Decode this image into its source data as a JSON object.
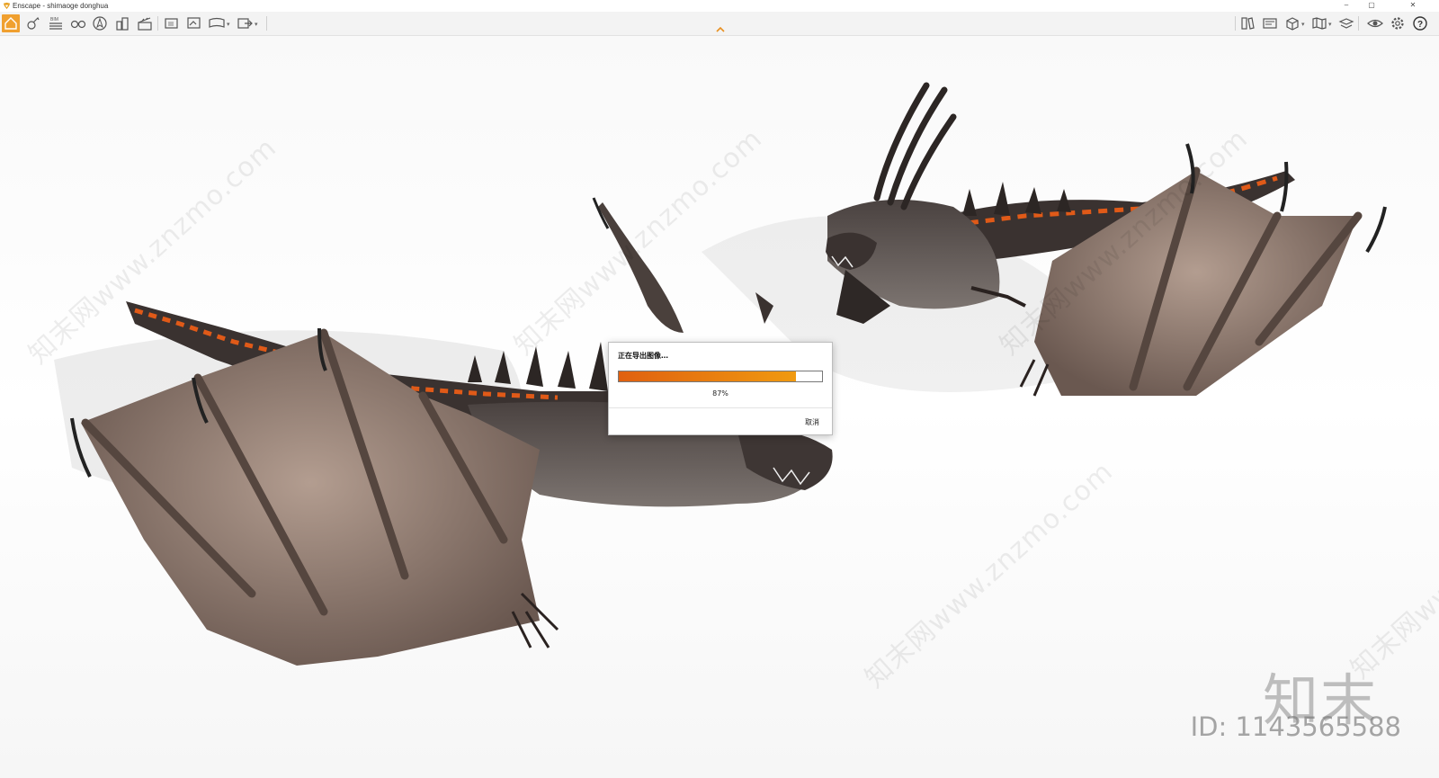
{
  "window": {
    "title": "Enscape - shimaoge donghua",
    "min_glyph": "–",
    "max_glyph": "▢",
    "close_glyph": "✕"
  },
  "toolbar": {
    "left_icons": [
      "home-icon",
      "assets-icon",
      "bim-icon",
      "binoculars-icon",
      "navigation-icon",
      "buildings-icon",
      "clapper-icon",
      "screenshot-icon",
      "batch-render-icon",
      "panorama-icon",
      "export-icon"
    ],
    "right_icons": [
      "library-icon",
      "view-icon",
      "box-icon",
      "map-icon",
      "layers-icon",
      "eye-icon",
      "settings-icon",
      "help-icon"
    ],
    "bim_label": "BIM"
  },
  "dialog": {
    "title": "正在导出图像…",
    "progress": 0.87,
    "progress_text": "87%",
    "cancel_label": "取消"
  },
  "watermarks": {
    "repeat_text": "知末网www.znzmo.com",
    "brand": "知末",
    "id_text": "ID: 1143565588"
  },
  "colors": {
    "accent": "#f0a030",
    "progress_start": "#e06010",
    "progress_end": "#f09a10"
  }
}
